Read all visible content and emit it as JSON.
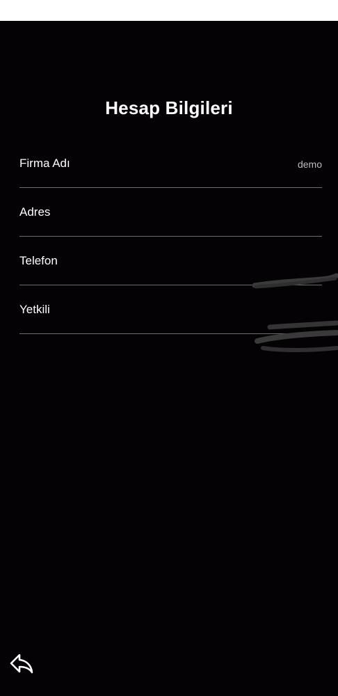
{
  "page": {
    "title": "Hesap Bilgileri"
  },
  "account": {
    "rows": [
      {
        "label": "Firma Adı",
        "value": "demo"
      },
      {
        "label": "Adres",
        "value": ""
      },
      {
        "label": "Telefon",
        "value": ""
      },
      {
        "label": "Yetkili",
        "value": ""
      }
    ]
  },
  "icons": {
    "back": "reply-arrow-icon"
  },
  "colors": {
    "background": "#040204",
    "text": "#ffffff",
    "value_text": "#bdbdbd",
    "divider": "#6e6e6e"
  }
}
